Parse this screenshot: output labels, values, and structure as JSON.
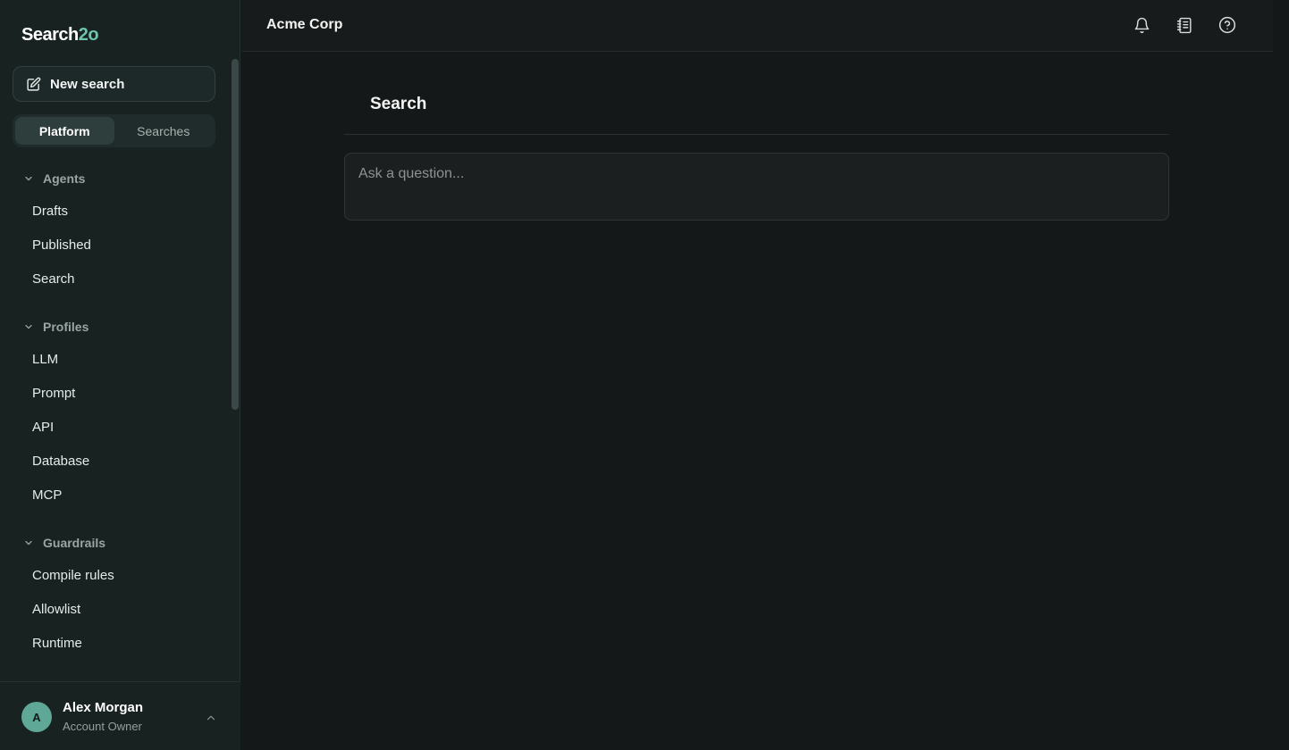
{
  "app": {
    "logo_part1": "Search",
    "logo_part2": "2o",
    "org_name": "Acme Corp"
  },
  "sidebar": {
    "new_search_label": "New search",
    "segments": [
      {
        "label": "Platform",
        "active": true
      },
      {
        "label": "Searches",
        "active": false
      }
    ],
    "sections": [
      {
        "title": "Agents",
        "items": [
          "Drafts",
          "Published",
          "Search"
        ]
      },
      {
        "title": "Profiles",
        "items": [
          "LLM",
          "Prompt",
          "API",
          "Database",
          "MCP"
        ]
      },
      {
        "title": "Guardrails",
        "items": [
          "Compile rules",
          "Allowlist",
          "Runtime"
        ]
      }
    ]
  },
  "user": {
    "initial": "A",
    "name": "Alex Morgan",
    "role": "Account Owner"
  },
  "header": {
    "icons": [
      "bell-icon",
      "notebook-icon",
      "help-icon"
    ]
  },
  "main": {
    "title": "Search",
    "input_placeholder": "Ask a question...",
    "input_value": ""
  },
  "colors": {
    "accent": "#6cc4ad",
    "sidebar_bg": "#172221",
    "main_bg": "#151818",
    "avatar_bg": "#5fa797"
  }
}
